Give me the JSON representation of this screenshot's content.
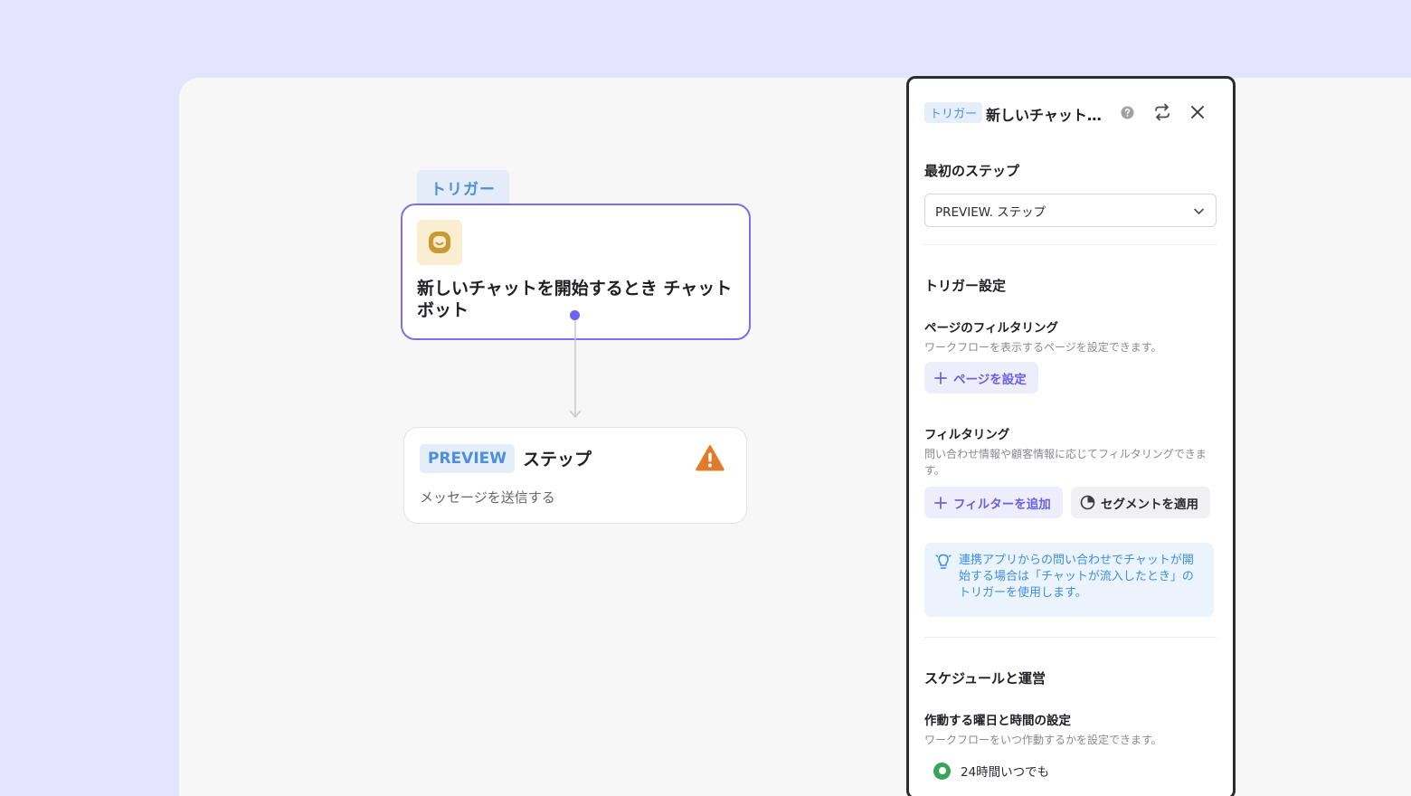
{
  "canvas": {
    "trigger_tab": "トリガー",
    "trigger_card": {
      "icon": "chat-bubble-icon",
      "title": "新しいチャットを開始するとき チャットボット"
    },
    "step_card": {
      "badge": "PREVIEW",
      "title": "ステップ",
      "subtitle": "メッセージを送信する",
      "status_icon": "warning-icon"
    }
  },
  "panel": {
    "header": {
      "badge": "トリガー",
      "title": "新しいチャットを開始するとき チャットボット"
    },
    "first_step": {
      "heading": "最初のステップ",
      "selected": "PREVIEW. ステップ"
    },
    "trigger_settings": {
      "heading": "トリガー設定",
      "page_filter": {
        "title": "ページのフィルタリング",
        "desc": "ワークフローを表示するページを設定できます。",
        "button": "ページを設定"
      },
      "filter": {
        "title": "フィルタリング",
        "desc": "問い合わせ情報や顧客情報に応じてフィルタリングできます。",
        "add_button": "フィルターを追加",
        "segment_button": "セグメントを適用"
      },
      "info": "連携アプリからの問い合わせでチャットが開始する場合は「チャットが流入したとき」のトリガーを使用します。"
    },
    "schedule": {
      "heading": "スケジュールと運営",
      "title": "作動する曜日と時間の設定",
      "desc": "ワークフローをいつ作動するかを設定できます。",
      "option": "24時間いつでも"
    }
  },
  "colors": {
    "accent": "#6e63ee",
    "preview_blue": "#4b8fda",
    "warning": "#e27a2c",
    "success": "#3aa55a"
  }
}
